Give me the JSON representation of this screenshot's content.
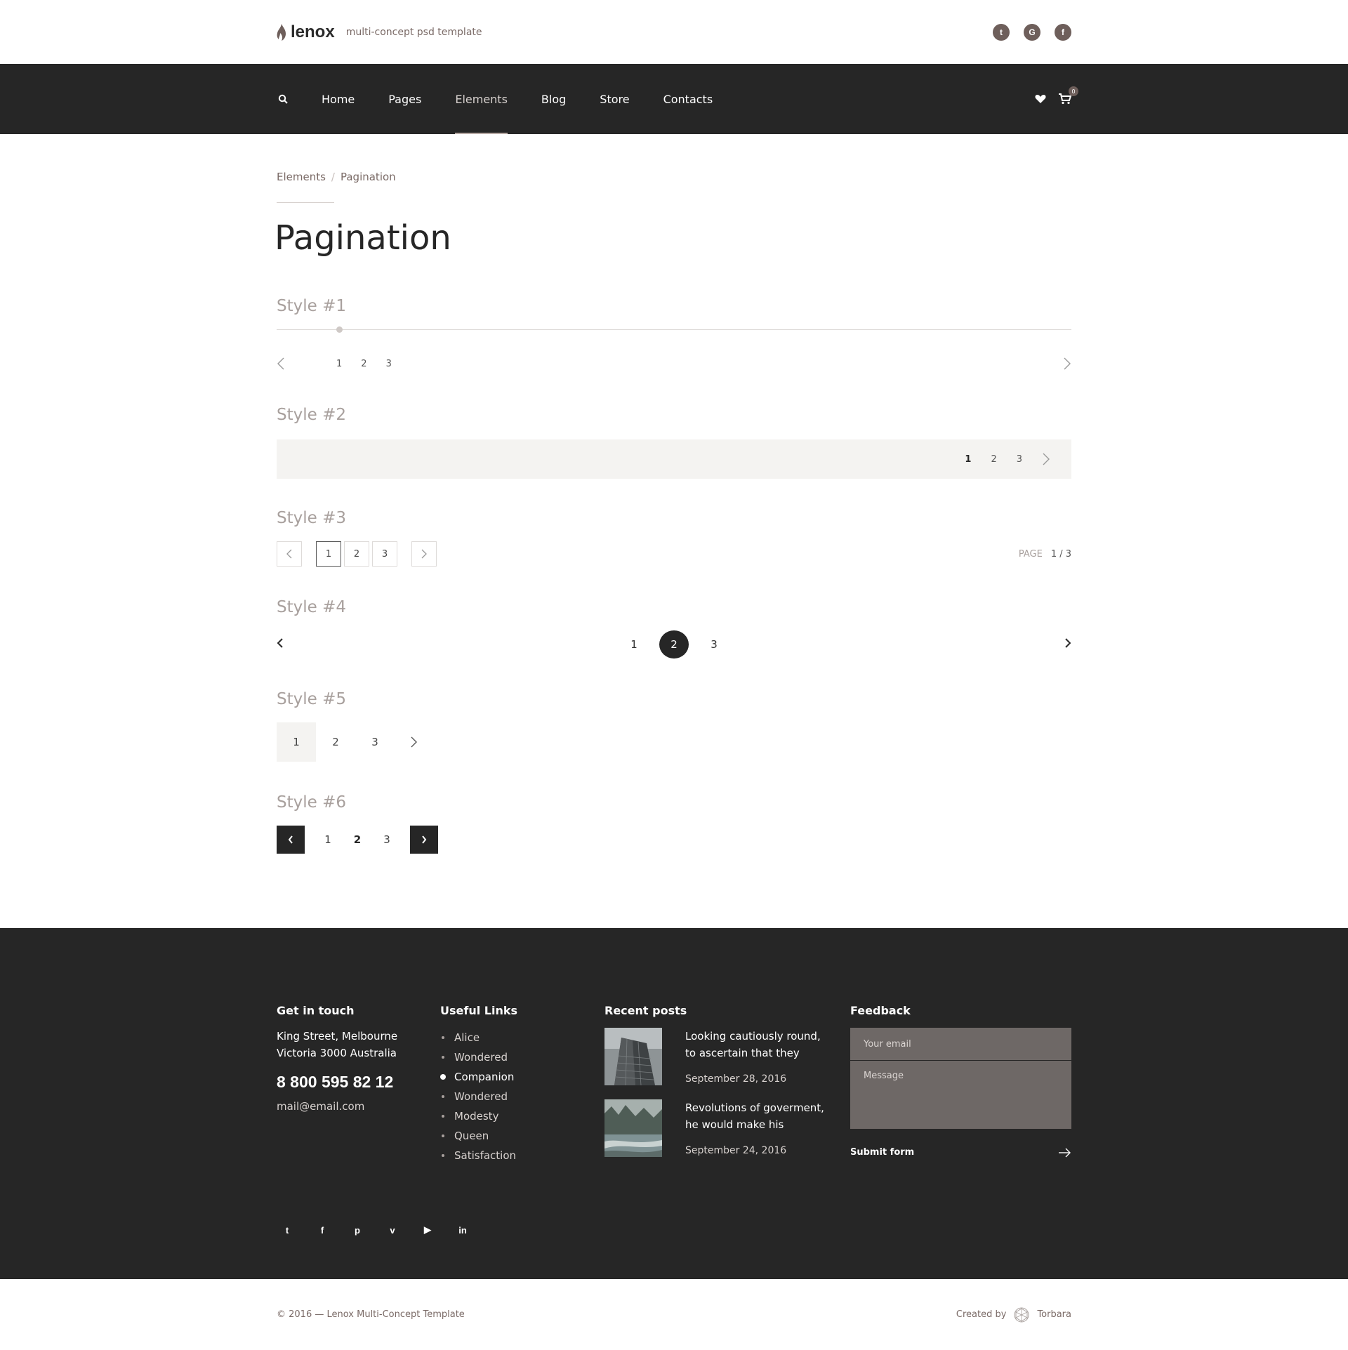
{
  "header": {
    "logo_text": "lenox",
    "tagline": "multi-concept psd template",
    "social": [
      {
        "icon": "twitter-icon",
        "glyph": "t"
      },
      {
        "icon": "google-icon",
        "glyph": "G"
      },
      {
        "icon": "facebook-icon",
        "glyph": "f"
      }
    ]
  },
  "nav": {
    "items": [
      "Home",
      "Pages",
      "Elements",
      "Blog",
      "Store",
      "Contacts"
    ],
    "active": "Elements",
    "cart_count": "0"
  },
  "breadcrumb": {
    "parent": "Elements",
    "separator": "/",
    "current": "Pagination"
  },
  "page_title": "Pagination",
  "styles": {
    "s1": {
      "label": "Style #1",
      "pages": [
        "1",
        "2",
        "3"
      ]
    },
    "s2": {
      "label": "Style #2",
      "pages": [
        "1",
        "2",
        "3"
      ]
    },
    "s3": {
      "label": "Style #3",
      "pages": [
        "1",
        "2",
        "3"
      ],
      "page_label": "PAGE",
      "page_value": "1 / 3"
    },
    "s4": {
      "label": "Style #4",
      "pages": [
        "1",
        "2",
        "3"
      ]
    },
    "s5": {
      "label": "Style #5",
      "pages": [
        "1",
        "2",
        "3"
      ]
    },
    "s6": {
      "label": "Style #6",
      "pages": [
        "1",
        "2",
        "3"
      ]
    }
  },
  "footer": {
    "contact": {
      "title": "Get in touch",
      "address_line1": "King Street, Melbourne",
      "address_line2": "Victoria 3000 Australia",
      "phone": "8 800 595 82 12",
      "email": "mail@email.com"
    },
    "links": {
      "title": "Useful Links",
      "items": [
        "Alice",
        "Wondered",
        "Companion",
        "Wondered",
        "Modesty",
        "Queen",
        "Satisfaction"
      ]
    },
    "posts": {
      "title": "Recent posts",
      "items": [
        {
          "title": "Looking cautiously round, to ascertain that they",
          "date": "September 28, 2016"
        },
        {
          "title": "Revolutions of goverment, he would make his",
          "date": "September 24, 2016"
        }
      ]
    },
    "feedback": {
      "title": "Feedback",
      "email_placeholder": "Your email",
      "message_placeholder": "Message",
      "submit_label": "Submit form"
    },
    "social": [
      "twitter-icon",
      "facebook-icon",
      "pinterest-icon",
      "vimeo-icon",
      "youtube-icon",
      "linkedin-icon"
    ],
    "social_glyphs": [
      "t",
      "f",
      "p",
      "v",
      "▶",
      "in"
    ]
  },
  "bottom": {
    "copyright": "© 2016 — Lenox Multi-Concept Template",
    "created_by_label": "Created by",
    "author": "Torbara"
  },
  "colors": {
    "dark": "#262626",
    "accent": "#6e5f5b",
    "muted": "#a8a09d",
    "light_bg": "#f4f3f1"
  }
}
